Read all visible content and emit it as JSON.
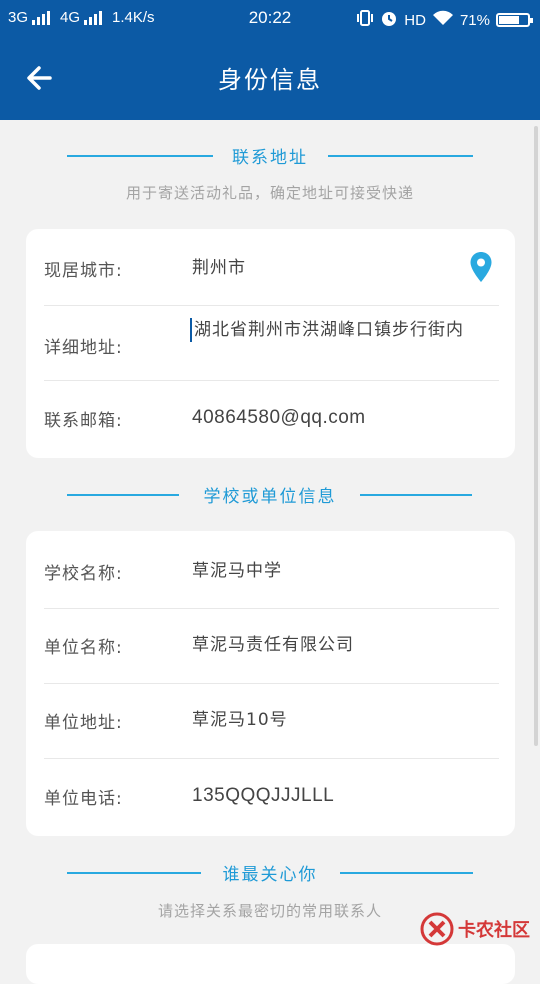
{
  "status_bar": {
    "network_1": "3G",
    "network_2": "4G",
    "speed": "1.4K/s",
    "time": "20:22",
    "hd": "HD",
    "battery_percent": "71%",
    "battery_level": 0.71
  },
  "header": {
    "title": "身份信息"
  },
  "sections": {
    "contact": {
      "title": "联系地址",
      "subtitle": "用于寄送活动礼品，确定地址可接受快递"
    },
    "school": {
      "title": "学校或单位信息"
    },
    "care": {
      "title": "谁最关心你",
      "subtitle": "请选择关系最密切的常用联系人"
    }
  },
  "contact_card": {
    "city_label": "现居城市:",
    "city_value": "荆州市",
    "address_label": "详细地址:",
    "address_value": "湖北省荆州市洪湖峰口镇步行街内",
    "email_label": "联系邮箱:",
    "email_value": "40864580@qq.com"
  },
  "school_card": {
    "school_label": "学校名称:",
    "school_value": "草泥马中学",
    "company_label": "单位名称:",
    "company_value": "草泥马责任有限公司",
    "company_address_label": "单位地址:",
    "company_address_value": "草泥马10号",
    "company_phone_label": "单位电话:",
    "company_phone_value": "135QQQJJJLLL"
  },
  "watermark": {
    "text": "卡农社区"
  },
  "colors": {
    "primary": "#0c5aa5",
    "accent": "#29a9e0",
    "background": "#f2f2f2"
  },
  "icons": {
    "back": "arrow-left-icon",
    "location": "location-pin-icon"
  }
}
